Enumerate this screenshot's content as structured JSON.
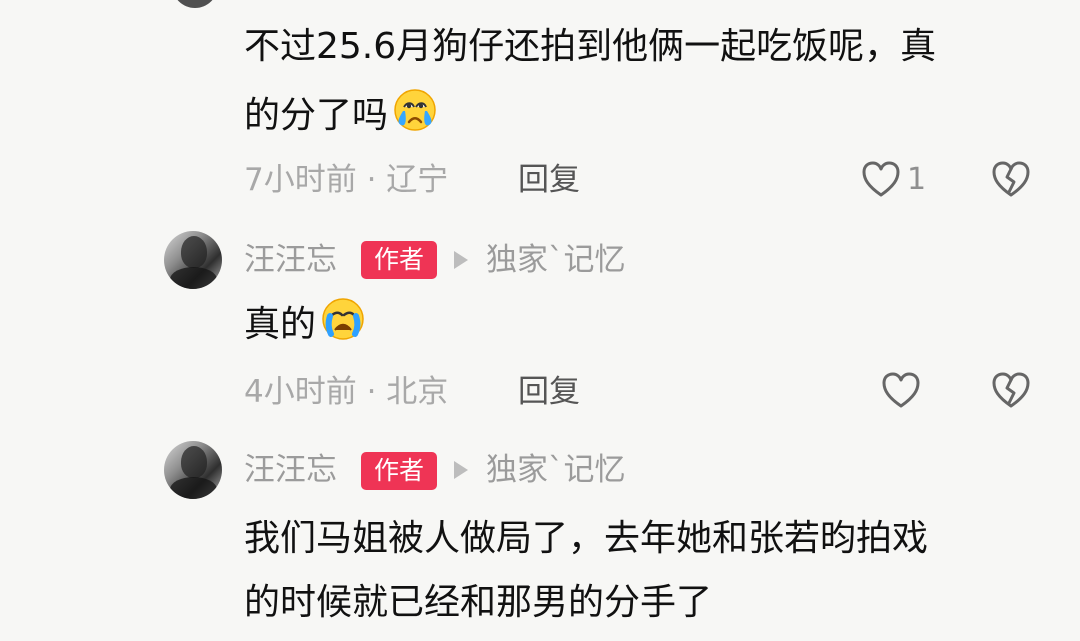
{
  "comments": [
    {
      "text_lines": [
        "不过25.6月狗仔还拍到他俩一起吃饭呢，真",
        "的分了吗"
      ],
      "emoji": "crying-face-icon",
      "meta": "7小时前 · 辽宁",
      "reply_label": "回复",
      "like_count": "1"
    },
    {
      "user": {
        "name": "汪汪忘",
        "badge": "作者",
        "reply_target": "独家`记忆"
      },
      "text": "真的",
      "emoji": "loudly-crying-face-icon",
      "meta": "4小时前 · 北京",
      "reply_label": "回复"
    },
    {
      "user": {
        "name": "汪汪忘",
        "badge": "作者",
        "reply_target": "独家`记忆"
      },
      "text_lines": [
        "我们马姐被人做局了，去年她和张若昀拍戏",
        "的时候就已经和那男的分手了"
      ]
    }
  ],
  "colors": {
    "background": "#f7f7f5",
    "author_badge": "#ef3455",
    "secondary_text": "#a8a8a8",
    "icon_stroke": "#666666"
  }
}
